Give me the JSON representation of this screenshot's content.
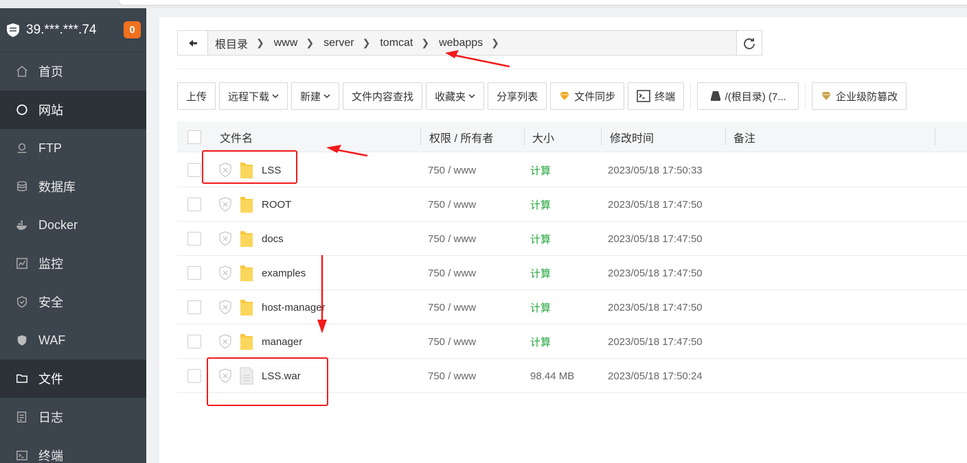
{
  "server": {
    "ip": "39.***.***.74",
    "badge": "0"
  },
  "sidebar": {
    "items": [
      {
        "label": "首页",
        "icon": "home-icon"
      },
      {
        "label": "网站",
        "icon": "globe-icon"
      },
      {
        "label": "FTP",
        "icon": "ftp-icon"
      },
      {
        "label": "数据库",
        "icon": "database-icon"
      },
      {
        "label": "Docker",
        "icon": "docker-icon"
      },
      {
        "label": "监控",
        "icon": "monitor-icon"
      },
      {
        "label": "安全",
        "icon": "shield-icon"
      },
      {
        "label": "WAF",
        "icon": "waf-icon"
      },
      {
        "label": "文件",
        "icon": "folder-icon"
      },
      {
        "label": "日志",
        "icon": "log-icon"
      },
      {
        "label": "终端",
        "icon": "terminal-icon"
      }
    ]
  },
  "breadcrumb": [
    "根目录",
    "www",
    "server",
    "tomcat",
    "webapps"
  ],
  "toolbar": {
    "upload": "上传",
    "remote_download": "远程下载",
    "new": "新建",
    "content_search": "文件内容查找",
    "favorites": "收藏夹",
    "share_list": "分享列表",
    "file_sync": "文件同步",
    "terminal": "终端",
    "disk": "/(根目录) (7...",
    "anti_tamper": "企业级防篡改"
  },
  "table": {
    "headers": {
      "name": "文件名",
      "perm": "权限 / 所有者",
      "size": "大小",
      "mtime": "修改时间",
      "note": "备注"
    },
    "rows": [
      {
        "name": "LSS",
        "type": "folder",
        "perm": "750 / www",
        "size": "计算",
        "mtime": "2023/05/18 17:50:33"
      },
      {
        "name": "ROOT",
        "type": "folder",
        "perm": "750 / www",
        "size": "计算",
        "mtime": "2023/05/18 17:47:50"
      },
      {
        "name": "docs",
        "type": "folder",
        "perm": "750 / www",
        "size": "计算",
        "mtime": "2023/05/18 17:47:50"
      },
      {
        "name": "examples",
        "type": "folder",
        "perm": "750 / www",
        "size": "计算",
        "mtime": "2023/05/18 17:47:50"
      },
      {
        "name": "host-manager",
        "type": "folder",
        "perm": "750 / www",
        "size": "计算",
        "mtime": "2023/05/18 17:47:50"
      },
      {
        "name": "manager",
        "type": "folder",
        "perm": "750 / www",
        "size": "计算",
        "mtime": "2023/05/18 17:47:50"
      },
      {
        "name": "LSS.war",
        "type": "file",
        "perm": "750 / www",
        "size": "98.44 MB",
        "mtime": "2023/05/18 17:50:24"
      }
    ]
  },
  "colors": {
    "sidebar_bg": "#3c444d",
    "active_bg": "#2c3238",
    "badge": "#f0711e",
    "green": "#20a53a",
    "annotation_red": "#f21b1b",
    "folder": "#f9c93c"
  }
}
